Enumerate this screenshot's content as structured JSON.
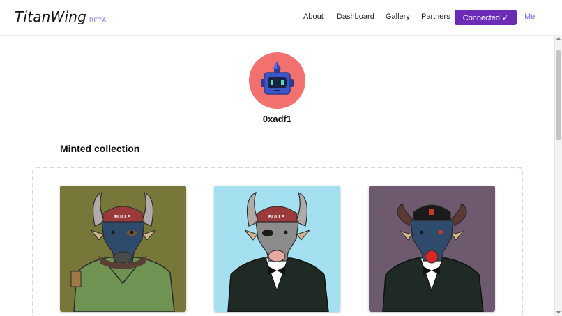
{
  "brand": {
    "name": "TitanWing",
    "tag": "BETA"
  },
  "nav": {
    "links": [
      "About",
      "Dashboard",
      "Gallery",
      "Partners"
    ],
    "connected_label": "Connected ✓",
    "me_label": "Me"
  },
  "profile": {
    "username": "0xadf1",
    "avatar_icon": "robot-icon",
    "avatar_bg": "#f2716f"
  },
  "collection": {
    "title": "Minted collection",
    "items": [
      {
        "icon": "bull-nft-image",
        "background": "#78773a",
        "cap_text": "BULLS"
      },
      {
        "icon": "bull-nft-image",
        "background": "#a4e0f0",
        "cap_text": "BULLS"
      },
      {
        "icon": "bull-nft-image",
        "background": "#6e5a6e"
      }
    ]
  },
  "colors": {
    "accent": "#6b2bb7",
    "link": "#6b6bd6"
  }
}
